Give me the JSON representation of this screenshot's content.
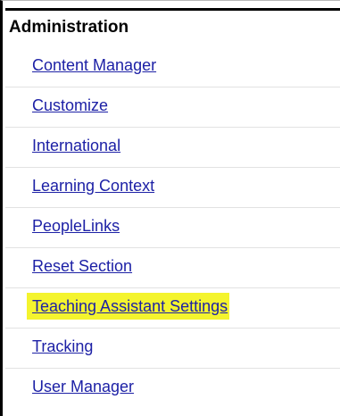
{
  "section": {
    "title": "Administration"
  },
  "menu": {
    "items": [
      {
        "label": "Content Manager"
      },
      {
        "label": "Customize"
      },
      {
        "label": "International"
      },
      {
        "label": "Learning Context"
      },
      {
        "label": "PeopleLinks"
      },
      {
        "label": "Reset Section"
      },
      {
        "label": "Teaching Assistant Settings",
        "highlighted": true
      },
      {
        "label": "Tracking"
      },
      {
        "label": "User Manager"
      }
    ]
  },
  "colors": {
    "link": "#1d21a6",
    "highlight": "#f4f42e"
  }
}
